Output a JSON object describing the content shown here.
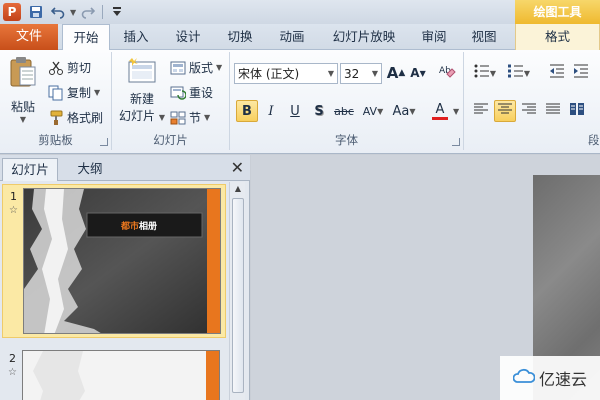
{
  "titlebar": {
    "app_icon_letter": "P",
    "qat": [
      "save-icon",
      "undo-icon",
      "redo-icon",
      "customize-icon"
    ],
    "contextual_label": "绘图工具"
  },
  "tabs": {
    "file": "文件",
    "items": [
      "开始",
      "插入",
      "设计",
      "切换",
      "动画",
      "幻灯片放映",
      "审阅",
      "视图",
      "格式"
    ],
    "active": "开始"
  },
  "ribbon": {
    "clipboard": {
      "label": "剪贴板",
      "paste": "粘贴",
      "cut": "剪切",
      "copy": "复制",
      "format_painter": "格式刷"
    },
    "slides": {
      "label": "幻灯片",
      "new_slide": "新建",
      "new_slide_2": "幻灯片",
      "layout": "版式",
      "reset": "重设",
      "section": "节"
    },
    "font": {
      "label": "字体",
      "font_name": "宋体 (正文)",
      "font_size": "32",
      "grow": "A",
      "shrink": "A",
      "bold": "B",
      "italic": "I",
      "underline": "U",
      "shadow": "S",
      "strike": "abc",
      "spacing": "AV",
      "change_case": "Aa",
      "font_color": "A"
    },
    "paragraph": {
      "label_partial": "段"
    }
  },
  "panel": {
    "tab_slides": "幻灯片",
    "tab_outline": "大纲",
    "slides": [
      {
        "number": "1",
        "title": "都市相册"
      },
      {
        "number": "2"
      }
    ]
  },
  "watermark": {
    "text": "亿速云"
  },
  "colors": {
    "file_tab": "#d65a25",
    "accent_orange": "#e8761e",
    "selection": "#fbe9a5",
    "drawing_tools": "#f1bf38"
  }
}
